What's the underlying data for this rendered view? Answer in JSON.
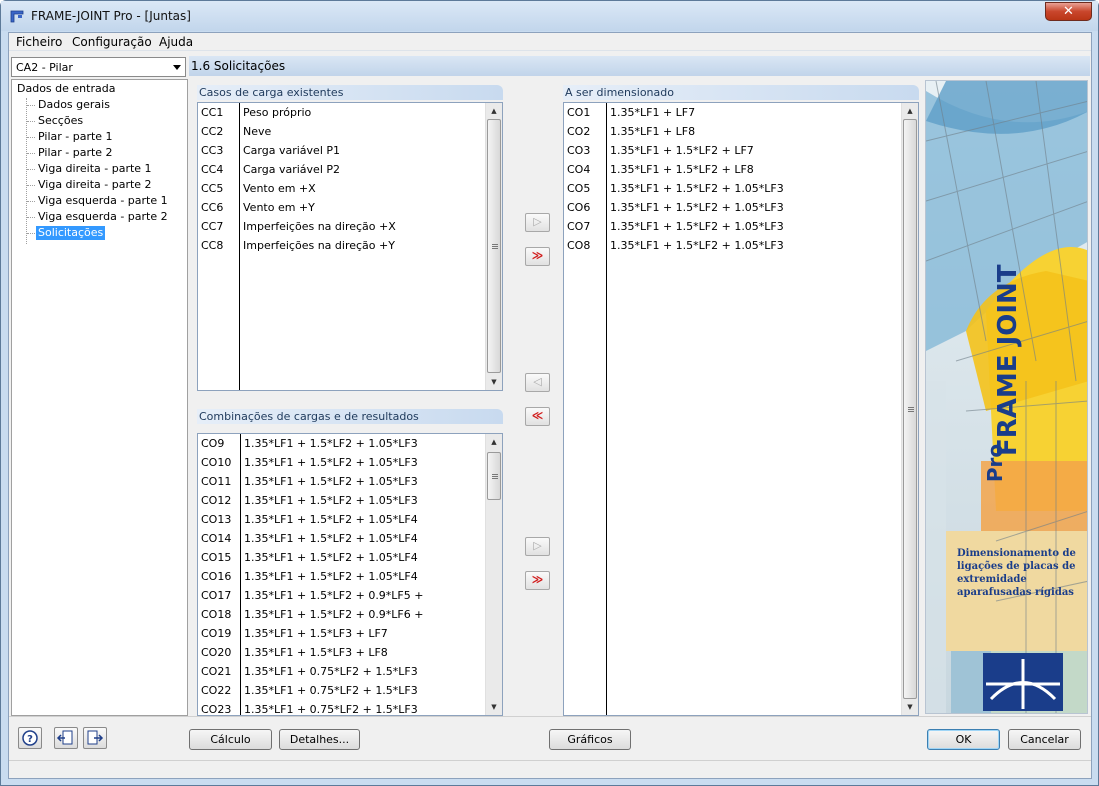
{
  "window": {
    "title": "FRAME-JOINT Pro - [Juntas]",
    "close_label": "✕"
  },
  "menu": [
    "Ficheiro",
    "Configuração",
    "Ajuda"
  ],
  "combo": {
    "value": "CA2 - Pilar"
  },
  "nav": {
    "root": "Dados de entrada",
    "items": [
      "Dados gerais",
      "Secções",
      "Pilar - parte 1",
      "Pilar - parte 2",
      "Viga direita - parte 1",
      "Viga direita - parte 2",
      "Viga esquerda - parte 1",
      "Viga esquerda - parte 2",
      "Solicitações"
    ],
    "selected_index": 8
  },
  "section_title": "1.6 Solicitações",
  "existing_cases": {
    "header": "Casos de carga existentes",
    "rows": [
      [
        "CC1",
        "Peso próprio"
      ],
      [
        "CC2",
        "Neve"
      ],
      [
        "CC3",
        "Carga variável P1"
      ],
      [
        "CC4",
        "Carga variável P2"
      ],
      [
        "CC5",
        "Vento em +X"
      ],
      [
        "CC6",
        "Vento em +Y"
      ],
      [
        "CC7",
        "Imperfeições na direção +X"
      ],
      [
        "CC8",
        "Imperfeições na direção +Y"
      ]
    ]
  },
  "combinations": {
    "header": "Combinações de cargas e de resultados",
    "rows": [
      [
        "CO9",
        "1.35*LF1 + 1.5*LF2 + 1.05*LF3"
      ],
      [
        "CO10",
        "1.35*LF1 + 1.5*LF2 + 1.05*LF3"
      ],
      [
        "CO11",
        "1.35*LF1 + 1.5*LF2 + 1.05*LF3"
      ],
      [
        "CO12",
        "1.35*LF1 + 1.5*LF2 + 1.05*LF3"
      ],
      [
        "CO13",
        "1.35*LF1 + 1.5*LF2 + 1.05*LF4"
      ],
      [
        "CO14",
        "1.35*LF1 + 1.5*LF2 + 1.05*LF4"
      ],
      [
        "CO15",
        "1.35*LF1 + 1.5*LF2 + 1.05*LF4"
      ],
      [
        "CO16",
        "1.35*LF1 + 1.5*LF2 + 1.05*LF4"
      ],
      [
        "CO17",
        "1.35*LF1 + 1.5*LF2 + 0.9*LF5 +"
      ],
      [
        "CO18",
        "1.35*LF1 + 1.5*LF2 + 0.9*LF6 +"
      ],
      [
        "CO19",
        "1.35*LF1 + 1.5*LF3 + LF7"
      ],
      [
        "CO20",
        "1.35*LF1 + 1.5*LF3 + LF8"
      ],
      [
        "CO21",
        "1.35*LF1 + 0.75*LF2 + 1.5*LF3"
      ],
      [
        "CO22",
        "1.35*LF1 + 0.75*LF2 + 1.5*LF3"
      ],
      [
        "CO23",
        "1.35*LF1 + 0.75*LF2 + 1.5*LF3"
      ]
    ]
  },
  "to_design": {
    "header": "A ser dimensionado",
    "rows": [
      [
        "CO1",
        "1.35*LF1 + LF7"
      ],
      [
        "CO2",
        "1.35*LF1 + LF8"
      ],
      [
        "CO3",
        "1.35*LF1 + 1.5*LF2 + LF7"
      ],
      [
        "CO4",
        "1.35*LF1 + 1.5*LF2 + LF8"
      ],
      [
        "CO5",
        "1.35*LF1 + 1.5*LF2 + 1.05*LF3"
      ],
      [
        "CO6",
        "1.35*LF1 + 1.5*LF2 + 1.05*LF3"
      ],
      [
        "CO7",
        "1.35*LF1 + 1.5*LF2 + 1.05*LF3"
      ],
      [
        "CO8",
        "1.35*LF1 + 1.5*LF2 + 1.05*LF3"
      ]
    ]
  },
  "transfer_buttons": {
    "add_one": "▷",
    "add_all": "≫",
    "remove_one": "◁",
    "remove_all": "≪"
  },
  "banner": {
    "title": "FRAME JOINT",
    "subtitle": "Pro",
    "description": "Dimensionamento de ligações de placas de extremidade aparafusadas rígidas"
  },
  "buttons": {
    "calc": "Cálculo",
    "details": "Detalhes...",
    "graphics": "Gráficos",
    "ok": "OK",
    "cancel": "Cancelar"
  },
  "colors": {
    "accent": "#3399ff",
    "transfer_red": "#d11a1a",
    "title_blue": "#1a3d8a"
  }
}
